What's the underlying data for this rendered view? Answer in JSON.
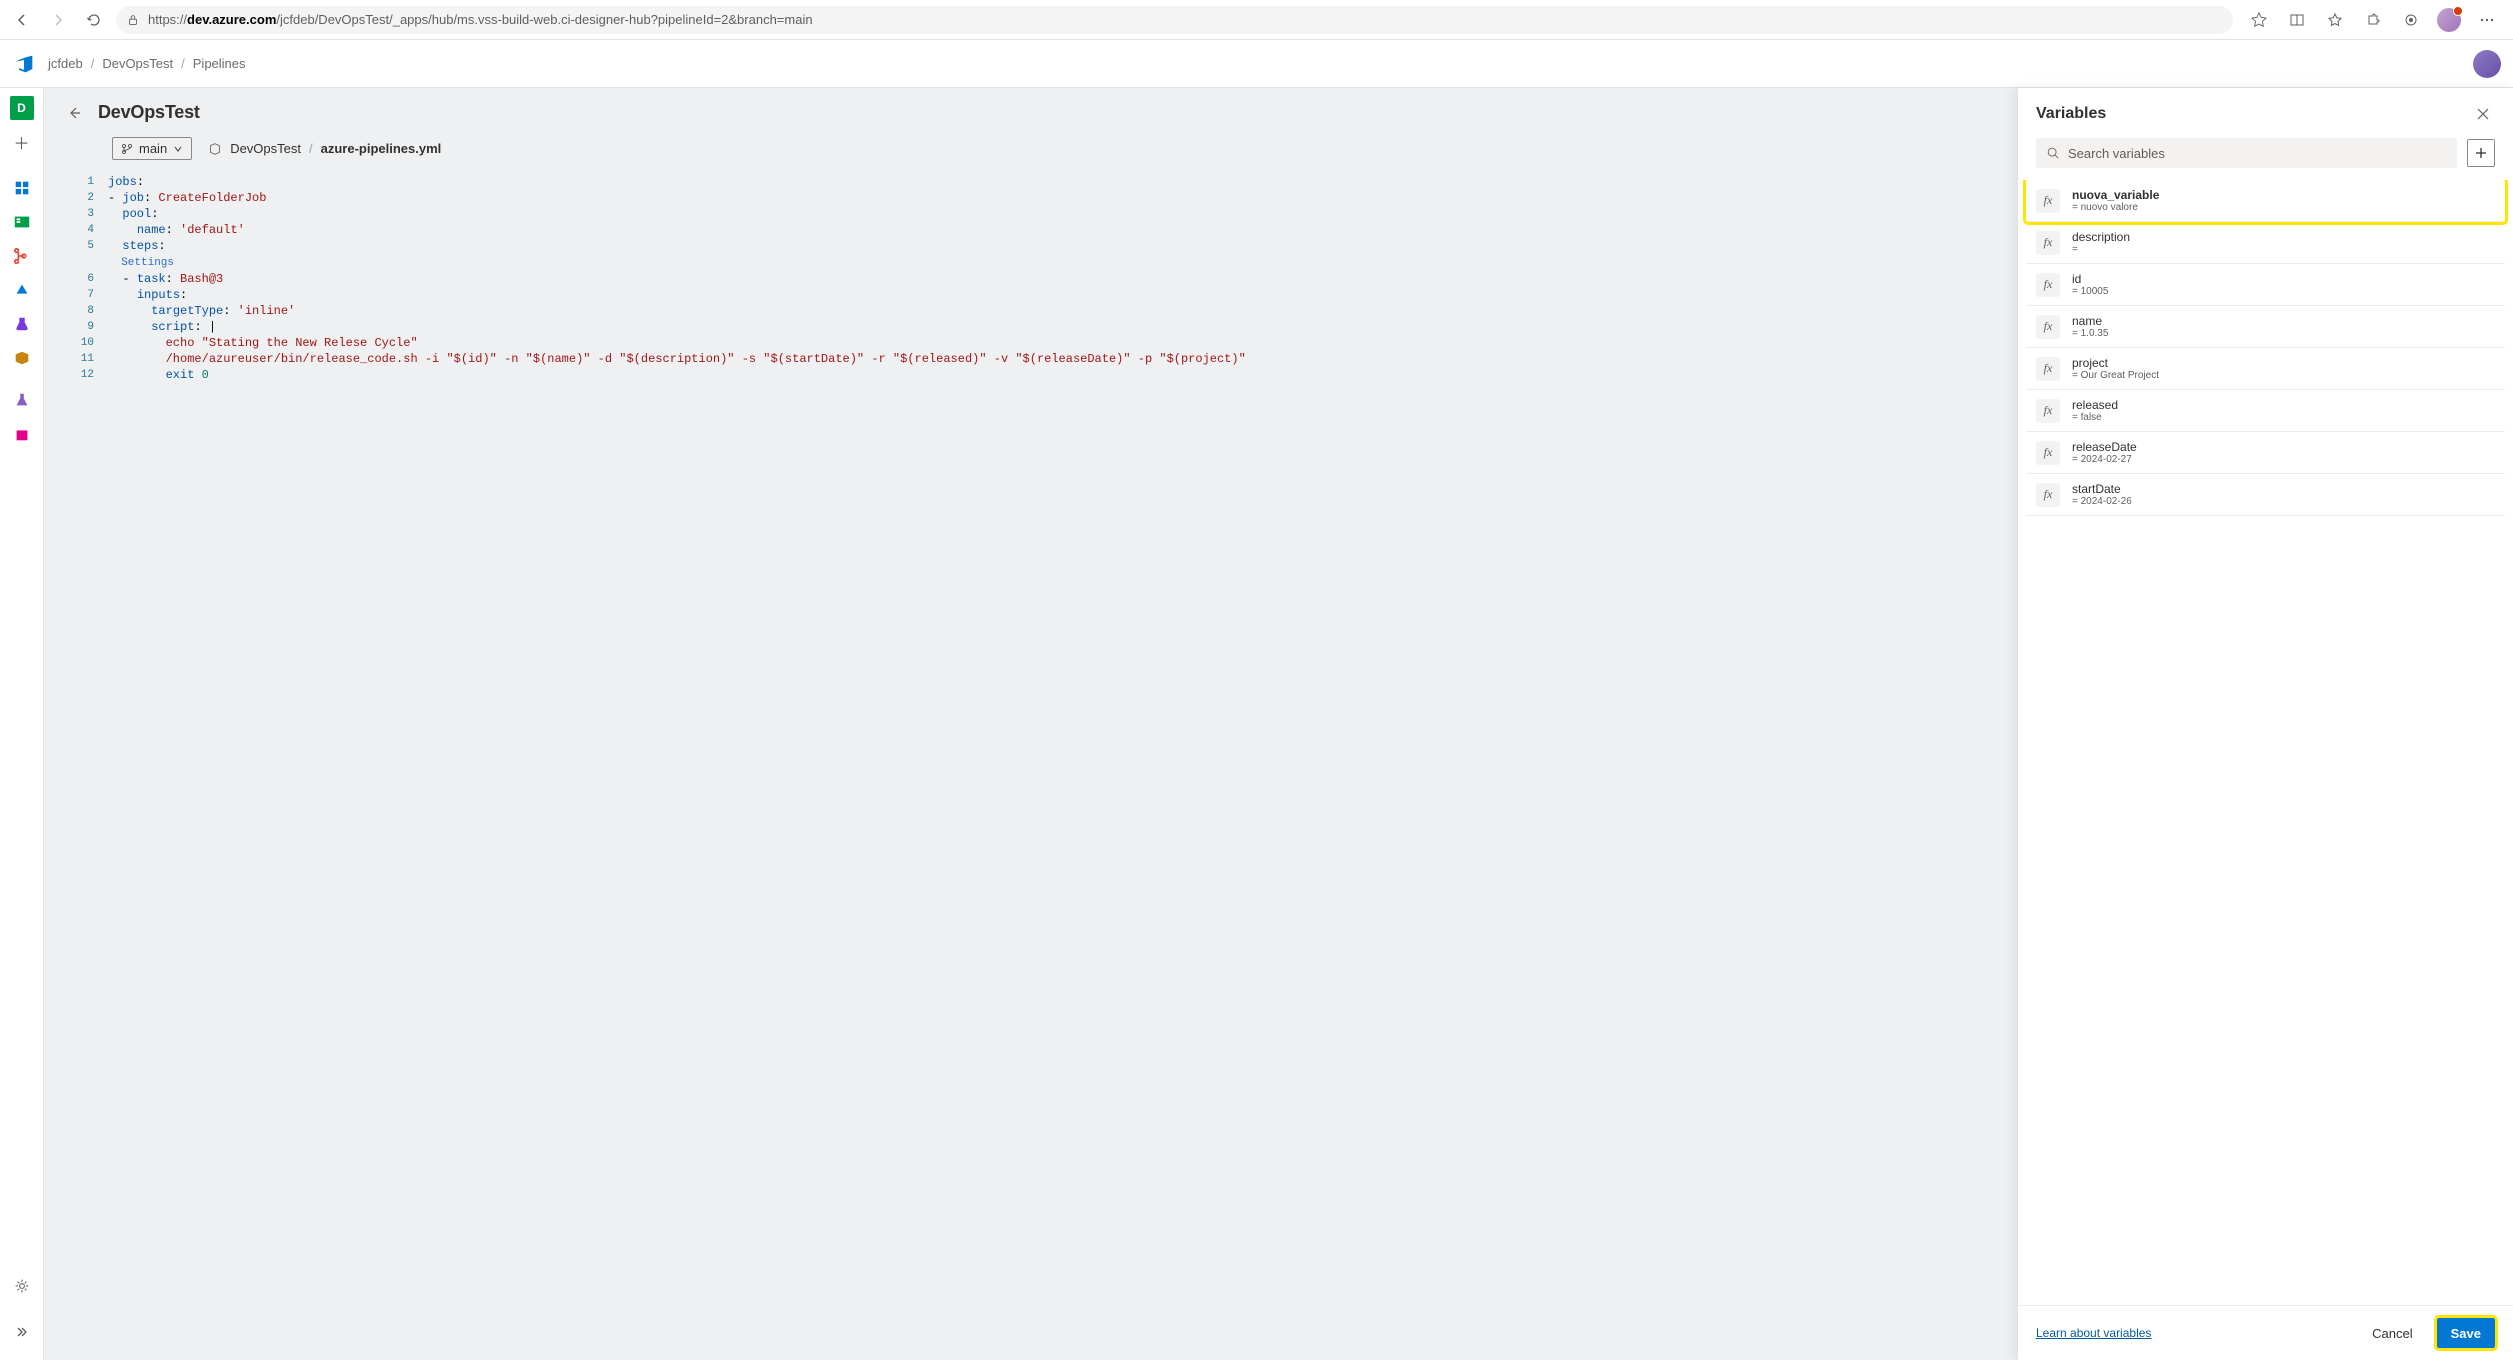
{
  "browser": {
    "url_prefix": "https://",
    "url_host_pre": "",
    "url_host_bold": "dev.azure.com",
    "url_path": "/jcfdeb/DevOpsTest/_apps/hub/ms.vss-build-web.ci-designer-hub?pipelineId=2&branch=main"
  },
  "breadcrumbs": {
    "items": [
      "jcfdeb",
      "DevOpsTest",
      "Pipelines"
    ]
  },
  "page": {
    "title": "DevOpsTest",
    "branch_label": "main",
    "repo_name": "DevOpsTest",
    "file_name": "azure-pipelines.yml"
  },
  "editor": {
    "lines": [
      {
        "n": 1,
        "tokens": [
          {
            "t": "jobs",
            "c": "tok-key"
          },
          {
            "t": ":",
            "c": "tok-punc"
          }
        ]
      },
      {
        "n": 2,
        "tokens": [
          {
            "t": "- ",
            "c": "tok-punc"
          },
          {
            "t": "job",
            "c": "tok-key"
          },
          {
            "t": ": ",
            "c": "tok-punc"
          },
          {
            "t": "CreateFolderJob",
            "c": "tok-str"
          }
        ]
      },
      {
        "n": 3,
        "tokens": [
          {
            "t": "  ",
            "c": ""
          },
          {
            "t": "pool",
            "c": "tok-key"
          },
          {
            "t": ":",
            "c": "tok-punc"
          }
        ]
      },
      {
        "n": 4,
        "tokens": [
          {
            "t": "    ",
            "c": ""
          },
          {
            "t": "name",
            "c": "tok-key"
          },
          {
            "t": ": ",
            "c": "tok-punc"
          },
          {
            "t": "'default'",
            "c": "tok-str"
          }
        ]
      },
      {
        "n": 5,
        "tokens": [
          {
            "t": "  ",
            "c": ""
          },
          {
            "t": "steps",
            "c": "tok-key"
          },
          {
            "t": ":",
            "c": "tok-punc"
          }
        ]
      },
      {
        "n": "",
        "tokens": [
          {
            "t": "  Settings",
            "c": "tok-settings"
          }
        ]
      },
      {
        "n": 6,
        "tokens": [
          {
            "t": "  - ",
            "c": "tok-punc"
          },
          {
            "t": "task",
            "c": "tok-key"
          },
          {
            "t": ": ",
            "c": "tok-punc"
          },
          {
            "t": "Bash@3",
            "c": "tok-str"
          }
        ]
      },
      {
        "n": 7,
        "tokens": [
          {
            "t": "    ",
            "c": ""
          },
          {
            "t": "inputs",
            "c": "tok-key"
          },
          {
            "t": ":",
            "c": "tok-punc"
          }
        ]
      },
      {
        "n": 8,
        "tokens": [
          {
            "t": "      ",
            "c": ""
          },
          {
            "t": "targetType",
            "c": "tok-key"
          },
          {
            "t": ": ",
            "c": "tok-punc"
          },
          {
            "t": "'inline'",
            "c": "tok-str"
          }
        ]
      },
      {
        "n": 9,
        "tokens": [
          {
            "t": "      ",
            "c": ""
          },
          {
            "t": "script",
            "c": "tok-key"
          },
          {
            "t": ": |",
            "c": "tok-punc"
          }
        ]
      },
      {
        "n": 10,
        "tokens": [
          {
            "t": "        ",
            "c": ""
          },
          {
            "t": "echo \"Stating the New Relese Cycle\"",
            "c": "tok-str"
          }
        ]
      },
      {
        "n": 11,
        "tokens": [
          {
            "t": "        ",
            "c": ""
          },
          {
            "t": "/home/azureuser/bin/release_code.sh -i \"$(id)\" -n \"$(name)\" -d \"$(description)\" -s \"$(startDate)\" -r \"$(released)\" -v \"$(releaseDate)\" -p \"$(project)\"",
            "c": "tok-str"
          }
        ]
      },
      {
        "n": 12,
        "tokens": [
          {
            "t": "        ",
            "c": ""
          },
          {
            "t": "exit ",
            "c": "tok-key"
          },
          {
            "t": "0",
            "c": "tok-num"
          }
        ]
      }
    ]
  },
  "variables_panel": {
    "title": "Variables",
    "search_placeholder": "Search variables",
    "learn_link": "Learn about variables",
    "cancel_label": "Cancel",
    "save_label": "Save",
    "items": [
      {
        "name": "nuova_variable",
        "value": "= nuovo valore",
        "highlighted": true,
        "bold": true
      },
      {
        "name": "description",
        "value": "="
      },
      {
        "name": "id",
        "value": "= 10005"
      },
      {
        "name": "name",
        "value": "= 1.0.35"
      },
      {
        "name": "project",
        "value": "= Our Great Project"
      },
      {
        "name": "released",
        "value": "= false"
      },
      {
        "name": "releaseDate",
        "value": "= 2024-02-27"
      },
      {
        "name": "startDate",
        "value": "= 2024-02-26"
      }
    ]
  },
  "left_rail": {
    "project_initial": "D"
  }
}
